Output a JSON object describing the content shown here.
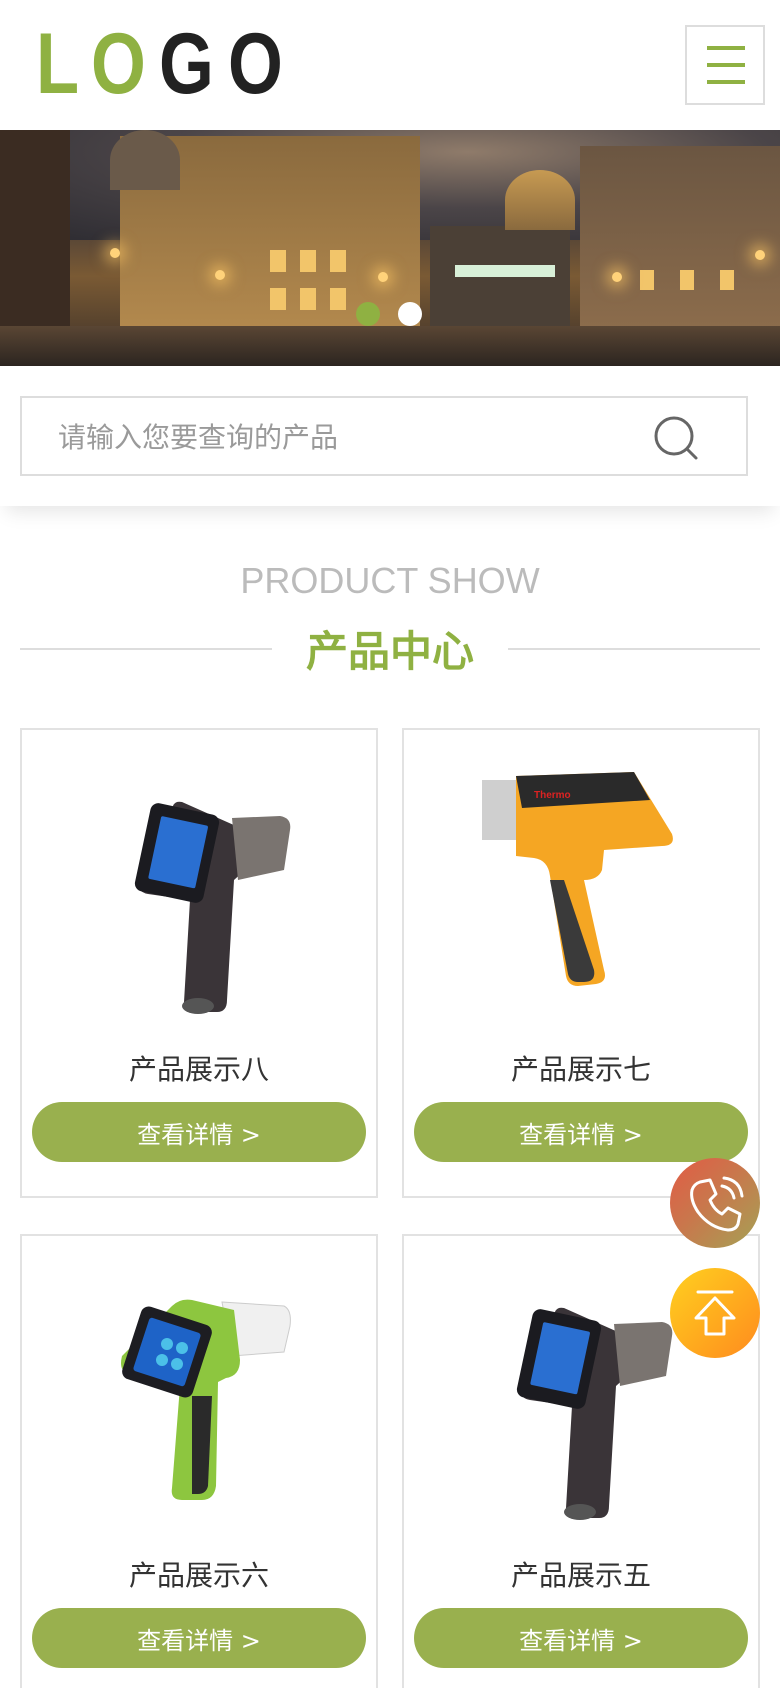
{
  "header": {
    "logo": {
      "letters": [
        "L",
        "O",
        "G",
        "O"
      ]
    },
    "menu_icon": "hamburger-menu-icon"
  },
  "banner": {
    "slides": 2,
    "active_slide": 1
  },
  "search": {
    "placeholder": "请输入您要查询的产品",
    "icon": "search-icon"
  },
  "section": {
    "title_en": "PRODUCT SHOW",
    "title_cn": "产品中心"
  },
  "products": [
    {
      "name": "产品展示八",
      "button": "查看详情 >"
    },
    {
      "name": "产品展示七",
      "button": "查看详情 >"
    },
    {
      "name": "产品展示六",
      "button": "查看详情 >"
    },
    {
      "name": "产品展示五",
      "button": "查看详情 >"
    }
  ],
  "colors": {
    "accent": "#8fb142",
    "button": "#99b04e"
  },
  "floating": {
    "phone_icon": "phone-icon",
    "top_icon": "arrow-up-icon"
  }
}
